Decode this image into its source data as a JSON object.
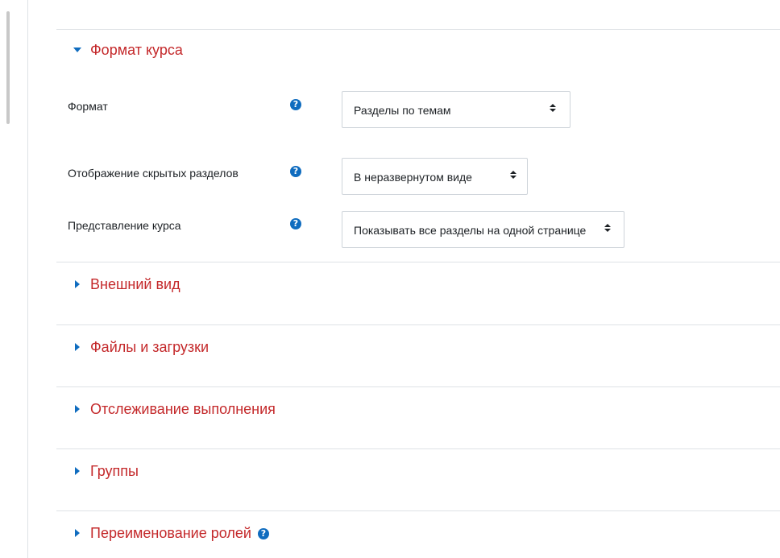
{
  "sections": {
    "course_format": {
      "title": "Формат курса",
      "expanded": true,
      "fields": {
        "format": {
          "label": "Формат",
          "value": "Разделы по темам",
          "help_icon": "question-circle-icon"
        },
        "hidden_sections": {
          "label": "Отображение скрытых разделов",
          "value": "В неразвернутом виде",
          "help_icon": "question-circle-icon"
        },
        "course_layout": {
          "label": "Представление курса",
          "value": "Показывать все разделы на одной странице",
          "help_icon": "question-circle-icon"
        }
      }
    },
    "appearance": {
      "title": "Внешний вид",
      "expanded": false
    },
    "files_uploads": {
      "title": "Файлы и загрузки",
      "expanded": false
    },
    "completion_tracking": {
      "title": "Отслеживание выполнения",
      "expanded": false
    },
    "groups": {
      "title": "Группы",
      "expanded": false
    },
    "role_renaming": {
      "title": "Переименование ролей",
      "expanded": false,
      "help_icon": "question-circle-icon"
    }
  },
  "colors": {
    "section_title": "#c4292b",
    "accent": "#0f6cbf",
    "border": "#dee2e6",
    "input_border": "#ced4da"
  }
}
